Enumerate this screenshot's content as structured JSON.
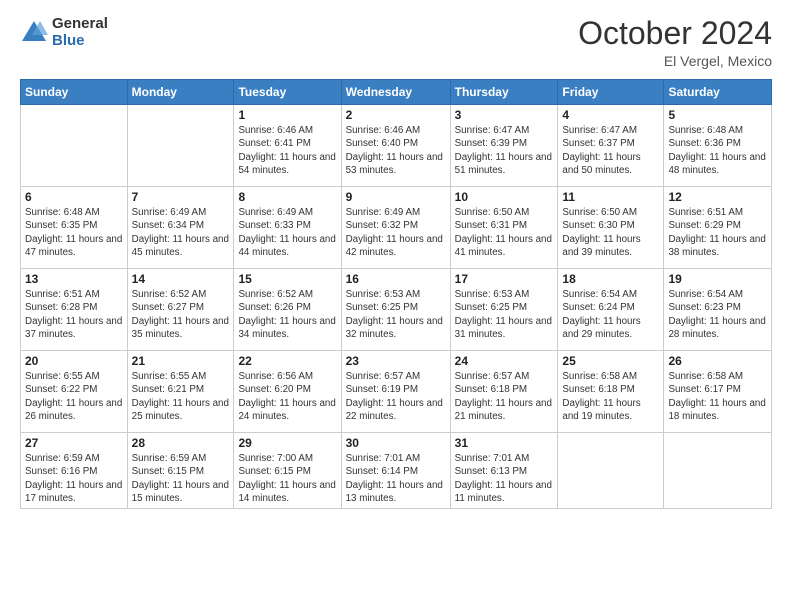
{
  "logo": {
    "general": "General",
    "blue": "Blue"
  },
  "header": {
    "title": "October 2024",
    "subtitle": "El Vergel, Mexico"
  },
  "days_of_week": [
    "Sunday",
    "Monday",
    "Tuesday",
    "Wednesday",
    "Thursday",
    "Friday",
    "Saturday"
  ],
  "weeks": [
    [
      {
        "day": "",
        "info": ""
      },
      {
        "day": "",
        "info": ""
      },
      {
        "day": "1",
        "info": "Sunrise: 6:46 AM\nSunset: 6:41 PM\nDaylight: 11 hours and 54 minutes."
      },
      {
        "day": "2",
        "info": "Sunrise: 6:46 AM\nSunset: 6:40 PM\nDaylight: 11 hours and 53 minutes."
      },
      {
        "day": "3",
        "info": "Sunrise: 6:47 AM\nSunset: 6:39 PM\nDaylight: 11 hours and 51 minutes."
      },
      {
        "day": "4",
        "info": "Sunrise: 6:47 AM\nSunset: 6:37 PM\nDaylight: 11 hours and 50 minutes."
      },
      {
        "day": "5",
        "info": "Sunrise: 6:48 AM\nSunset: 6:36 PM\nDaylight: 11 hours and 48 minutes."
      }
    ],
    [
      {
        "day": "6",
        "info": "Sunrise: 6:48 AM\nSunset: 6:35 PM\nDaylight: 11 hours and 47 minutes."
      },
      {
        "day": "7",
        "info": "Sunrise: 6:49 AM\nSunset: 6:34 PM\nDaylight: 11 hours and 45 minutes."
      },
      {
        "day": "8",
        "info": "Sunrise: 6:49 AM\nSunset: 6:33 PM\nDaylight: 11 hours and 44 minutes."
      },
      {
        "day": "9",
        "info": "Sunrise: 6:49 AM\nSunset: 6:32 PM\nDaylight: 11 hours and 42 minutes."
      },
      {
        "day": "10",
        "info": "Sunrise: 6:50 AM\nSunset: 6:31 PM\nDaylight: 11 hours and 41 minutes."
      },
      {
        "day": "11",
        "info": "Sunrise: 6:50 AM\nSunset: 6:30 PM\nDaylight: 11 hours and 39 minutes."
      },
      {
        "day": "12",
        "info": "Sunrise: 6:51 AM\nSunset: 6:29 PM\nDaylight: 11 hours and 38 minutes."
      }
    ],
    [
      {
        "day": "13",
        "info": "Sunrise: 6:51 AM\nSunset: 6:28 PM\nDaylight: 11 hours and 37 minutes."
      },
      {
        "day": "14",
        "info": "Sunrise: 6:52 AM\nSunset: 6:27 PM\nDaylight: 11 hours and 35 minutes."
      },
      {
        "day": "15",
        "info": "Sunrise: 6:52 AM\nSunset: 6:26 PM\nDaylight: 11 hours and 34 minutes."
      },
      {
        "day": "16",
        "info": "Sunrise: 6:53 AM\nSunset: 6:25 PM\nDaylight: 11 hours and 32 minutes."
      },
      {
        "day": "17",
        "info": "Sunrise: 6:53 AM\nSunset: 6:25 PM\nDaylight: 11 hours and 31 minutes."
      },
      {
        "day": "18",
        "info": "Sunrise: 6:54 AM\nSunset: 6:24 PM\nDaylight: 11 hours and 29 minutes."
      },
      {
        "day": "19",
        "info": "Sunrise: 6:54 AM\nSunset: 6:23 PM\nDaylight: 11 hours and 28 minutes."
      }
    ],
    [
      {
        "day": "20",
        "info": "Sunrise: 6:55 AM\nSunset: 6:22 PM\nDaylight: 11 hours and 26 minutes."
      },
      {
        "day": "21",
        "info": "Sunrise: 6:55 AM\nSunset: 6:21 PM\nDaylight: 11 hours and 25 minutes."
      },
      {
        "day": "22",
        "info": "Sunrise: 6:56 AM\nSunset: 6:20 PM\nDaylight: 11 hours and 24 minutes."
      },
      {
        "day": "23",
        "info": "Sunrise: 6:57 AM\nSunset: 6:19 PM\nDaylight: 11 hours and 22 minutes."
      },
      {
        "day": "24",
        "info": "Sunrise: 6:57 AM\nSunset: 6:18 PM\nDaylight: 11 hours and 21 minutes."
      },
      {
        "day": "25",
        "info": "Sunrise: 6:58 AM\nSunset: 6:18 PM\nDaylight: 11 hours and 19 minutes."
      },
      {
        "day": "26",
        "info": "Sunrise: 6:58 AM\nSunset: 6:17 PM\nDaylight: 11 hours and 18 minutes."
      }
    ],
    [
      {
        "day": "27",
        "info": "Sunrise: 6:59 AM\nSunset: 6:16 PM\nDaylight: 11 hours and 17 minutes."
      },
      {
        "day": "28",
        "info": "Sunrise: 6:59 AM\nSunset: 6:15 PM\nDaylight: 11 hours and 15 minutes."
      },
      {
        "day": "29",
        "info": "Sunrise: 7:00 AM\nSunset: 6:15 PM\nDaylight: 11 hours and 14 minutes."
      },
      {
        "day": "30",
        "info": "Sunrise: 7:01 AM\nSunset: 6:14 PM\nDaylight: 11 hours and 13 minutes."
      },
      {
        "day": "31",
        "info": "Sunrise: 7:01 AM\nSunset: 6:13 PM\nDaylight: 11 hours and 11 minutes."
      },
      {
        "day": "",
        "info": ""
      },
      {
        "day": "",
        "info": ""
      }
    ]
  ]
}
